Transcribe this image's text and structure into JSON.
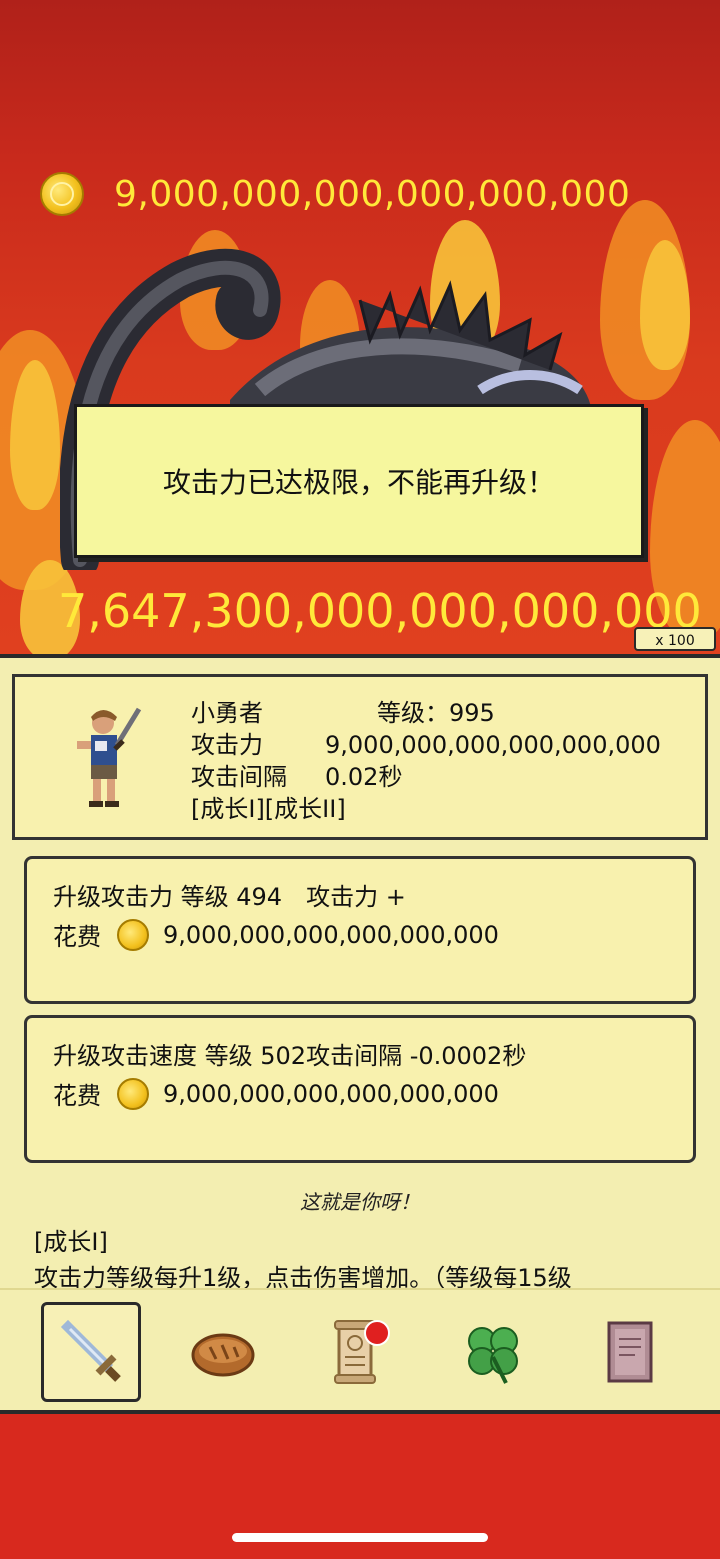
{
  "hud": {
    "gold": "9,000,000,000,000,000,000",
    "damage": "7,647,300,000,000,000,000",
    "multiplier": "x 100"
  },
  "toast": {
    "message": "攻击力已达极限，不能再升级！"
  },
  "hero": {
    "name": "小勇者",
    "level_text": "等级：995",
    "attack_label": "攻击力",
    "attack_value": "9,000,000,000,000,000,000",
    "interval_label": "攻击间隔",
    "interval_value": "0.02秒",
    "tags": "[成长I][成长II]"
  },
  "upgrades": [
    {
      "title": "升级攻击力 等级 494　攻击力 +",
      "cost_label": "花费",
      "cost": "9,000,000,000,000,000,000"
    },
    {
      "title": "升级攻击速度 等级 502攻击间隔 -0.0002秒",
      "cost_label": "花费",
      "cost": "9,000,000,000,000,000,000"
    }
  ],
  "description": {
    "title": "这就是你呀！",
    "tag": "[成长I]",
    "text": "攻击力等级每升1级，点击伤害增加。（等级每15级"
  },
  "tabs": [
    {
      "icon": "sword-icon",
      "active": true
    },
    {
      "icon": "bread-icon",
      "active": false
    },
    {
      "icon": "scroll-icon",
      "active": false,
      "badge": true
    },
    {
      "icon": "clover-icon",
      "active": false
    },
    {
      "icon": "book-icon",
      "active": false
    }
  ],
  "colors": {
    "background_red": "#d8291e",
    "gold_text": "#ffe93a",
    "panel": "#f3eeb1",
    "toast": "#f6f79e",
    "badge": "#e02020"
  }
}
